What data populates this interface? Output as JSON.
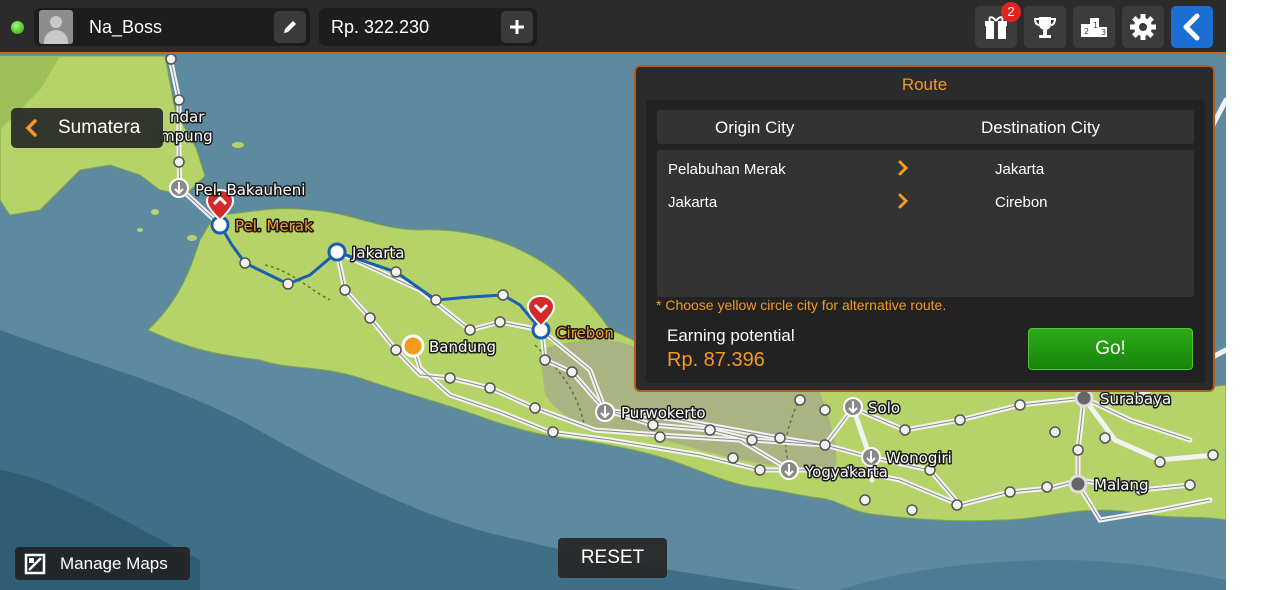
{
  "player": {
    "name": "Na_Boss"
  },
  "money": {
    "amount": "Rp. 322.230"
  },
  "toolbar": {
    "gift_badge": "2"
  },
  "region": {
    "label": "Sumatera"
  },
  "map": {
    "cities": [
      {
        "label": "ndar",
        "highlight": false
      },
      {
        "label": "mpung",
        "highlight": false
      },
      {
        "label": "Pel. Bakauheni",
        "highlight": false
      },
      {
        "label": "Pel. Merak",
        "highlight": true
      },
      {
        "label": "Jakarta",
        "highlight": false
      },
      {
        "label": "Cirebon",
        "highlight": true
      },
      {
        "label": "Bandung",
        "highlight": false
      },
      {
        "label": "Purwokerto",
        "highlight": false
      },
      {
        "label": "Solo",
        "highlight": false
      },
      {
        "label": "Wonogiri",
        "highlight": false
      },
      {
        "label": "Yogyakarta",
        "highlight": false
      },
      {
        "label": "Surabaya",
        "highlight": false
      },
      {
        "label": "Malang",
        "highlight": false
      }
    ]
  },
  "route_panel": {
    "title": "Route",
    "origin_header": "Origin City",
    "destination_header": "Destination City",
    "rows": [
      {
        "origin": "Pelabuhan Merak",
        "destination": "Jakarta"
      },
      {
        "origin": "Jakarta",
        "destination": "Cirebon"
      }
    ],
    "note": "* Choose yellow circle city for alternative route.",
    "earning_label": "Earning potential",
    "earning_value": "Rp. 87.396",
    "go_label": "Go!"
  },
  "manage_maps": {
    "label": "Manage Maps"
  },
  "reset": {
    "label": "RESET"
  },
  "colors": {
    "accent_orange": "#f39a1f",
    "route_blue": "#1a5fb4",
    "land_green": "#b5d368",
    "sea": "#5e8aa0",
    "go_green": "#1f9a12"
  }
}
